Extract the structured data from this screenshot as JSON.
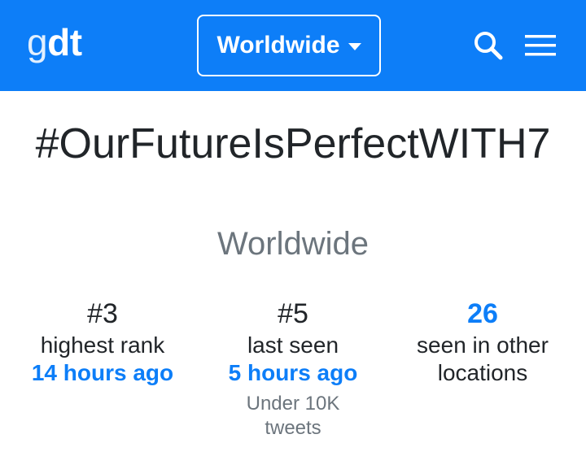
{
  "header": {
    "logo_light": "g",
    "logo_bold": "dt",
    "location_label": "Worldwide",
    "search_icon": "search-icon",
    "menu_icon": "hamburger-menu-icon"
  },
  "trend": {
    "name": "#OurFutureIsPerfectWITH7",
    "location": "Worldwide"
  },
  "stats": {
    "highest_rank": {
      "value": "#3",
      "label": "highest rank",
      "time": "14 hours ago"
    },
    "last_seen": {
      "value": "#5",
      "label": "last seen",
      "time": "5 hours ago",
      "note": "Under 10K tweets"
    },
    "other_locations": {
      "value": "26",
      "label": "seen in other locations"
    }
  },
  "colors": {
    "brand_blue": "#0d7ef8",
    "muted": "#6c757d",
    "text": "#212529"
  }
}
